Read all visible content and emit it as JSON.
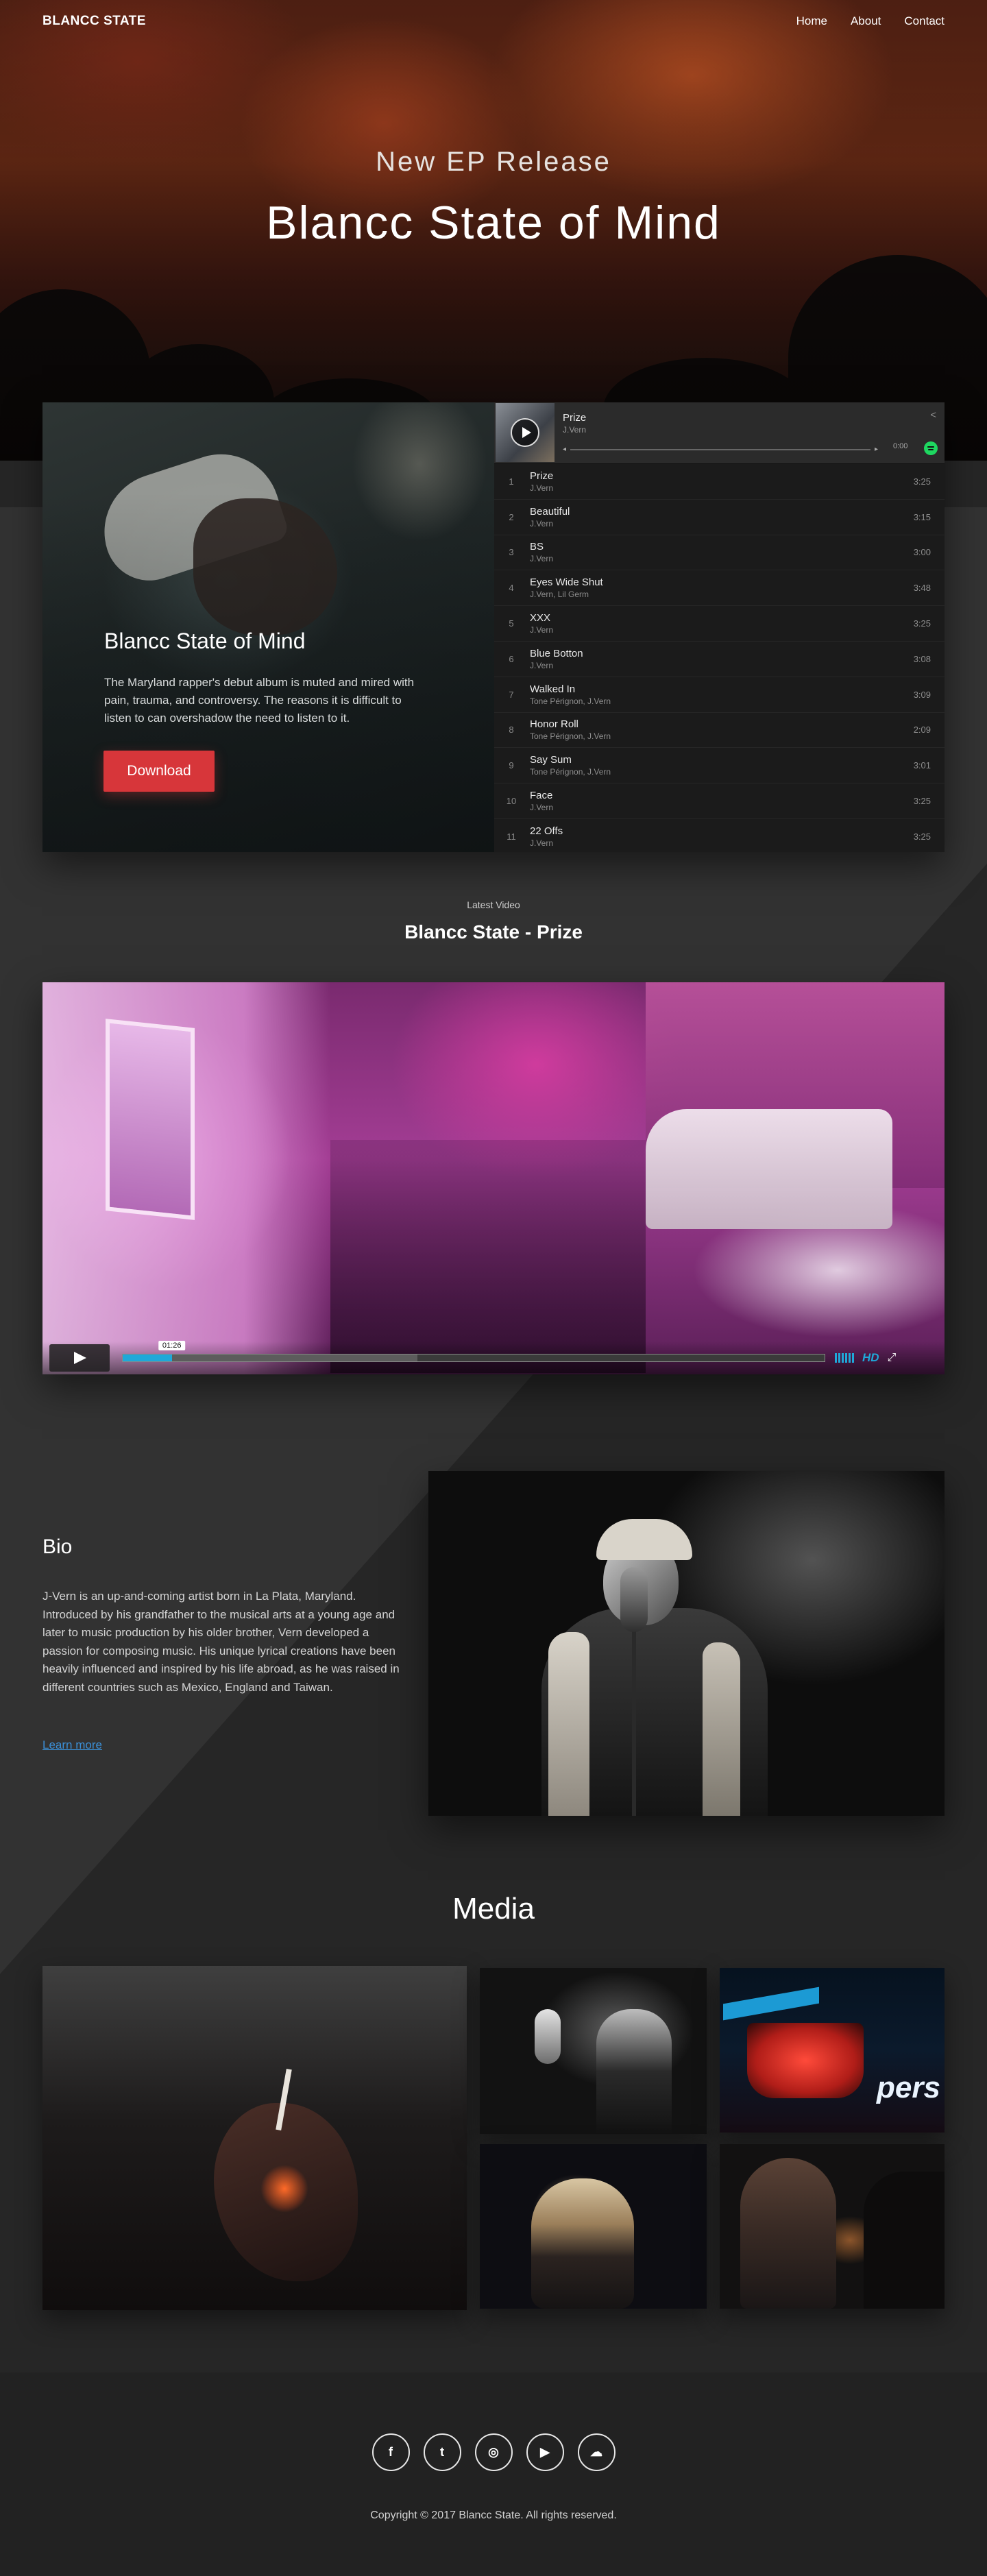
{
  "nav": {
    "brand": "BLANCC STATE",
    "links": [
      "Home",
      "About",
      "Contact"
    ]
  },
  "hero": {
    "subtitle": "New EP Release",
    "title": "Blancc State of Mind"
  },
  "album": {
    "title": "Blancc State of Mind",
    "description": "The Maryland rapper's debut album is muted and mired with pain, trauma, and controversy. The reasons it is difficult to listen to can overshadow the need to listen to it.",
    "download_label": "Download"
  },
  "player": {
    "now_playing_title": "Prize",
    "now_playing_artist": "J.Vern",
    "elapsed": "0:00",
    "icons": [
      "share-icon",
      "previous-icon",
      "next-icon",
      "spotify-icon",
      "play-icon"
    ],
    "tracks": [
      {
        "num": "1",
        "title": "Prize",
        "artist": "J.Vern",
        "duration": "3:25"
      },
      {
        "num": "2",
        "title": "Beautiful",
        "artist": "J.Vern",
        "duration": "3:15"
      },
      {
        "num": "3",
        "title": "BS",
        "artist": "J.Vern",
        "duration": "3:00"
      },
      {
        "num": "4",
        "title": "Eyes Wide Shut",
        "artist": "J.Vern, Lil Germ",
        "duration": "3:48"
      },
      {
        "num": "5",
        "title": "XXX",
        "artist": "J.Vern",
        "duration": "3:25"
      },
      {
        "num": "6",
        "title": "Blue Botton",
        "artist": "J.Vern",
        "duration": "3:08"
      },
      {
        "num": "7",
        "title": "Walked In",
        "artist": "Tone Pérignon, J.Vern",
        "duration": "3:09"
      },
      {
        "num": "8",
        "title": "Honor Roll",
        "artist": "Tone Pérignon, J.Vern",
        "duration": "2:09"
      },
      {
        "num": "9",
        "title": "Say Sum",
        "artist": "Tone Pérignon, J.Vern",
        "duration": "3:01"
      },
      {
        "num": "10",
        "title": "Face",
        "artist": "J.Vern",
        "duration": "3:25"
      },
      {
        "num": "11",
        "title": "22 Offs",
        "artist": "J.Vern",
        "duration": "3:25"
      }
    ]
  },
  "video": {
    "eyebrow": "Latest Video",
    "title": "Blancc State - Prize",
    "timestamp": "01:26",
    "played_fraction": 0.07,
    "buffered_fraction": 0.42,
    "hd_label": "HD",
    "accent_color": "#1fa8d9"
  },
  "bio": {
    "title": "Bio",
    "text": "J-Vern is an up-and-coming artist born in La Plata, Maryland. Introduced by his grandfather to the musical arts at a young age and later to music production by his older brother, Vern developed a passion for composing music. His unique lyrical creations have been heavily influenced and inspired by his life abroad, as he was raised in different countries such as Mexico, England and Taiwan.",
    "link_label": "Learn more"
  },
  "media": {
    "title": "Media",
    "tile3_sign_text": "pers"
  },
  "footer": {
    "socials": [
      {
        "name": "facebook-icon",
        "glyph": "f"
      },
      {
        "name": "twitter-icon",
        "glyph": "t"
      },
      {
        "name": "instagram-icon",
        "glyph": "◎"
      },
      {
        "name": "youtube-icon",
        "glyph": "▶"
      },
      {
        "name": "soundcloud-icon",
        "glyph": "☁"
      }
    ],
    "copyright": "Copyright © 2017 Blancc State. All rights reserved."
  },
  "colors": {
    "download_button": "#d7363a",
    "link": "#3b8fd6",
    "spotify": "#1ed760"
  }
}
